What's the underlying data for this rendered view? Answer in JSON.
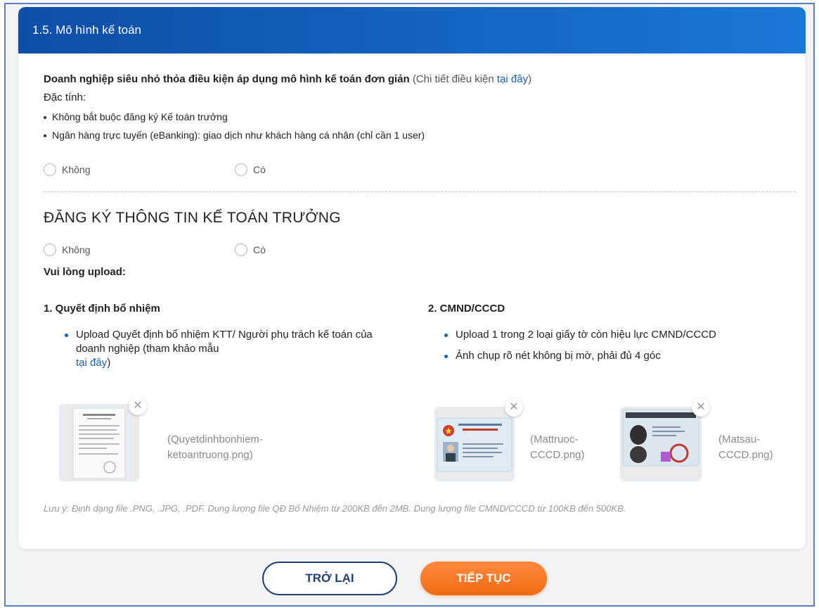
{
  "header": {
    "title": "1.5. Mô hình kế toán"
  },
  "simple_model": {
    "lead_bold": "Doanh nghiệp siêu nhỏ thỏa điều kiện áp dụng mô hình kế toán đơn giản",
    "lead_paren_open": " (Chi tiết điều kiện ",
    "lead_link": "tại đây",
    "lead_paren_close": ")",
    "traits_label": "Đặc tính:",
    "traits": [
      "Không bắt buộc đăng ký Kế toán trưởng",
      "Ngân hàng trực tuyến (eBanking): giao dịch như khách hàng cá nhân (chỉ cần 1 user)"
    ],
    "option_no": "Không",
    "option_yes": "Có"
  },
  "chief_accountant": {
    "title": "ĐĂNG KÝ THÔNG TIN KẾ TOÁN TRƯỞNG",
    "option_no": "Không",
    "option_yes": "Có",
    "upload_prompt": "Vui lòng upload:",
    "section1": {
      "title": "1. Quyết định bổ nhiệm",
      "bullet_text": "Upload Quyết định bổ nhiệm KTT/ Người phụ trách kế toán của doanh nghiệp (tham khảo mẫu",
      "bullet_link": "tại đây",
      "bullet_close": ")",
      "file_name": "(Quyetdinhbonhiem-ketoantruong.png)"
    },
    "section2": {
      "title": "2. CMND/CCCD",
      "bullets": [
        "Upload 1 trong 2 loại giấy tờ còn hiệu lực CMND/CCCD",
        "Ảnh chụp rõ nét không bị mờ, phải đủ 4 góc"
      ],
      "file_front": "(Mattruoc-CCCD.png)",
      "file_back": "(Matsau-CCCD.png)"
    },
    "note": "Lưu ý: Định dạng file .PNG, .JPG, .PDF. Dung lượng file QĐ Bổ Nhiệm từ 200KB đến 2MB. Dung lượng file CMND/CCCD từ 100KB đến 500KB."
  },
  "buttons": {
    "back": "TRỞ LẠI",
    "next": "TIẾP TỤC"
  },
  "icons": {
    "close": "close-icon",
    "radio": "radio-icon"
  },
  "colors": {
    "header": "#1a78d6",
    "accent_orange": "#f06a14",
    "link": "#1a5fb4"
  }
}
